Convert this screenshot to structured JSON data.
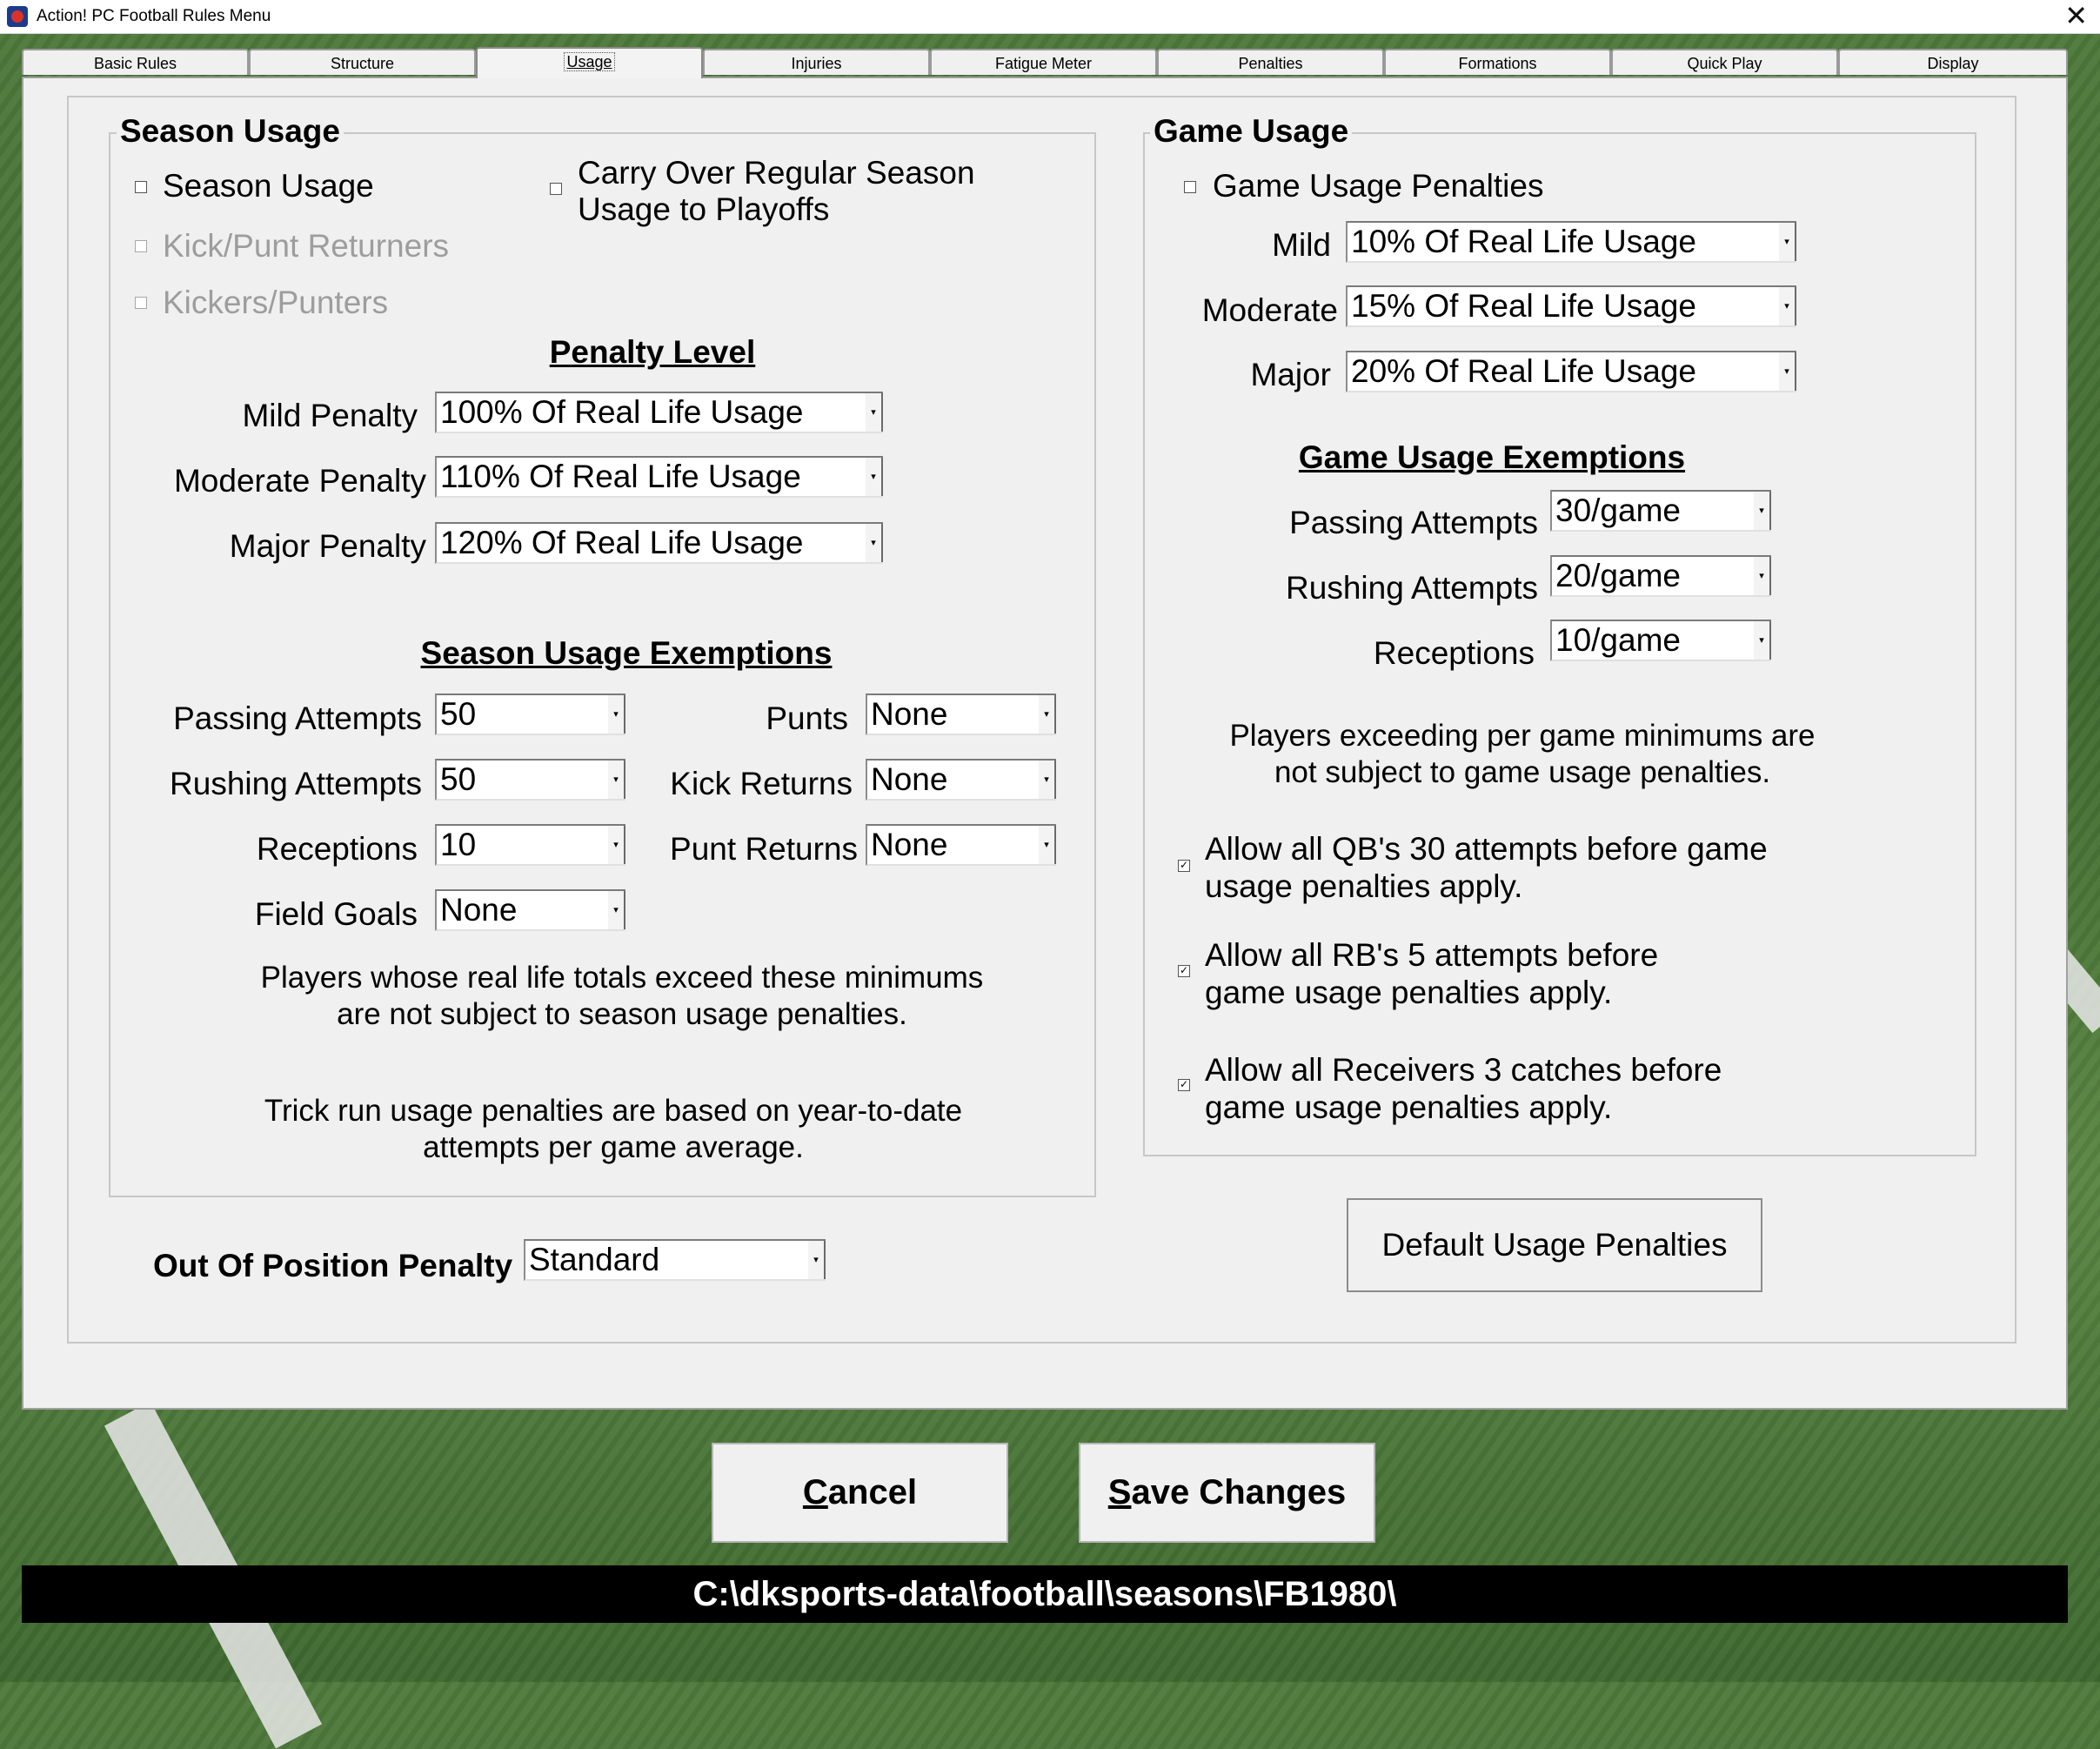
{
  "window": {
    "title": "Action! PC Football Rules Menu",
    "close_glyph": "✕"
  },
  "tabs": [
    {
      "label": "Basic Rules"
    },
    {
      "label": "Structure"
    },
    {
      "label": "Usage"
    },
    {
      "label": "Injuries"
    },
    {
      "label": "Fatigue Meter"
    },
    {
      "label": "Penalties"
    },
    {
      "label": "Formations"
    },
    {
      "label": "Quick Play"
    },
    {
      "label": "Display"
    }
  ],
  "active_tab": "Usage",
  "season_usage": {
    "group_title": "Season Usage",
    "season_usage_label": "Season Usage",
    "season_usage_checked": false,
    "carry_over_label_line1": "Carry Over Regular Season",
    "carry_over_label_line2": "Usage to Playoffs",
    "carry_over_checked": false,
    "kick_punt_returners_label": "Kick/Punt Returners",
    "kickers_punters_label": "Kickers/Punters",
    "penalty_level_heading": "Penalty Level",
    "mild_label": "Mild Penalty",
    "mild_value": "100% Of Real Life Usage",
    "moderate_label": "Moderate Penalty",
    "moderate_value": "110% Of Real Life Usage",
    "major_label": "Major Penalty",
    "major_value": "120% Of Real Life Usage",
    "exemptions_heading": "Season Usage Exemptions",
    "passing_label": "Passing Attempts",
    "passing_value": "50",
    "rushing_label": "Rushing Attempts",
    "rushing_value": "50",
    "receptions_label": "Receptions",
    "receptions_value": "10",
    "field_goals_label": "Field Goals",
    "field_goals_value": "None",
    "punts_label": "Punts",
    "punts_value": "None",
    "kick_returns_label": "Kick Returns",
    "kick_returns_value": "None",
    "punt_returns_label": "Punt Returns",
    "punt_returns_value": "None",
    "note1_line1": "Players whose real life totals exceed these minimums",
    "note1_line2": "are not subject to season usage penalties.",
    "note2_line1": "Trick run usage penalties are based on year-to-date",
    "note2_line2": "attempts per game average."
  },
  "game_usage": {
    "group_title": "Game Usage",
    "penalties_label": "Game Usage Penalties",
    "penalties_checked": false,
    "mild_label": "Mild",
    "mild_value": "10% Of Real Life Usage",
    "moderate_label": "Moderate",
    "moderate_value": "15% Of Real Life Usage",
    "major_label": "Major",
    "major_value": "20% Of Real Life Usage",
    "exemptions_heading": "Game Usage Exemptions",
    "passing_label": "Passing Attempts",
    "passing_value": "30/game",
    "rushing_label": "Rushing Attempts",
    "rushing_value": "20/game",
    "receptions_label": "Receptions",
    "receptions_value": "10/game",
    "note_line1": "Players exceeding per game minimums are",
    "note_line2": "not subject to game usage penalties.",
    "qb_line1": "Allow all QB's 30 attempts before game",
    "qb_line2": "usage penalties apply.",
    "qb_checked": true,
    "rb_line1": "Allow all RB's 5 attempts before",
    "rb_line2": "game usage penalties apply.",
    "rb_checked": true,
    "rec_line1": "Allow all Receivers 3 catches before",
    "rec_line2": "game usage penalties apply.",
    "rec_checked": true
  },
  "out_of_position": {
    "label": "Out Of Position Penalty",
    "value": "Standard"
  },
  "default_button_label": "Default Usage Penalties",
  "cancel": {
    "mnemonic": "C",
    "rest": "ancel"
  },
  "save": {
    "mnemonic": "S",
    "rest": "ave Changes"
  },
  "path": "C:\\dksports-data\\football\\seasons\\FB1980\\",
  "check_glyph": "✓",
  "arrow_glyph": "▾"
}
